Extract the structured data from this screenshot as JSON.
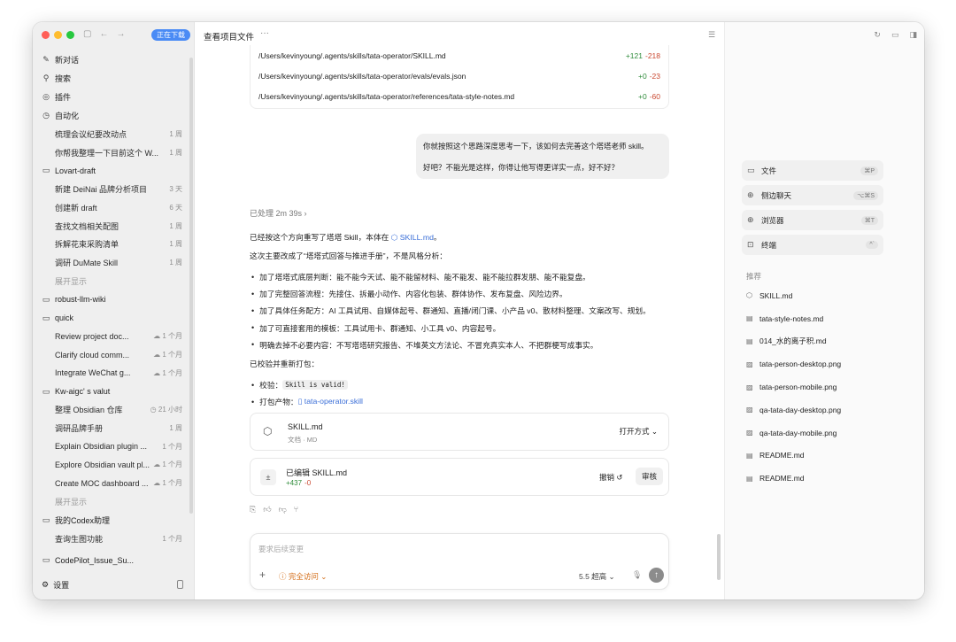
{
  "sidebar": {
    "download_badge": "正在下载",
    "top": [
      {
        "label": "新对话",
        "icon": "edit-icon"
      },
      {
        "label": "搜索",
        "icon": "search-icon"
      },
      {
        "label": "插件",
        "icon": "plugin-icon"
      }
    ],
    "automation": {
      "label": "自动化",
      "icon": "clock-icon"
    },
    "automation_items": [
      {
        "label": "梳理会议纪要改动点",
        "meta": "1 周"
      },
      {
        "label": "你帮我整理一下目前这个 W...",
        "meta": "1 周"
      }
    ],
    "group_lovart": "Lovart-draft",
    "lovart_items": [
      {
        "label": "新建 DeiNai 品牌分析项目",
        "meta": "3 天"
      },
      {
        "label": "创建新 draft",
        "meta": "6 天"
      },
      {
        "label": "查找文档相关配图",
        "meta": "1 周"
      },
      {
        "label": "拆解花束采购清单",
        "meta": "1 周"
      },
      {
        "label": "调研 DuMate Skill",
        "meta": "1 周"
      }
    ],
    "show_more": "展开显示",
    "group_robust": "robust-llm-wiki",
    "group_quick": "quick",
    "quick_items": [
      {
        "label": "Review project doc...",
        "meta": "☁ 1 个月"
      },
      {
        "label": "Clarify cloud comm...",
        "meta": "☁ 1 个月"
      },
      {
        "label": "Integrate WeChat g...",
        "meta": "☁ 1 个月"
      }
    ],
    "group_kw": "Kw-aigc' s valut",
    "kw_items": [
      {
        "label": "整理 Obsidian 仓库",
        "meta": "◷ 21 小时"
      },
      {
        "label": "调研品牌手册",
        "meta": "1 周"
      },
      {
        "label": "Explain Obsidian plugin ...",
        "meta": "1 个月"
      },
      {
        "label": "Explore Obsidian vault pl...",
        "meta": "☁ 1 个月"
      },
      {
        "label": "Create MOC dashboard ...",
        "meta": "☁ 1 个月"
      }
    ],
    "show_more_2": "展开显示",
    "group_codex": "我的Codex助理",
    "codex_items": [
      {
        "label": "查询生图功能",
        "meta": "1 个月"
      }
    ],
    "group_codepilot": "CodePilot_Issue_Su...",
    "settings": "设置"
  },
  "main": {
    "title": "查看项目文件",
    "more": "···",
    "files": [
      {
        "path": "/Users/kevinyoung/.agents/skills/tata-operator/SKILL.md",
        "add": "+121",
        "del": "-218"
      },
      {
        "path": "/Users/kevinyoung/.agents/skills/tata-operator/evals/evals.json",
        "add": "+0",
        "del": "-23"
      },
      {
        "path": "/Users/kevinyoung/.agents/skills/tata-operator/references/tata-style-notes.md",
        "add": "+0",
        "del": "-60"
      }
    ],
    "user_msg_1": "你就按照这个思路深度思考一下，该如何去完善这个塔塔老师 skill。",
    "user_msg_2": "好吧？不能光是这样，你得让他写得更详实一点，好不好？",
    "processed": "已处理 2m 39s",
    "reply_intro_prefix": "已经按这个方向重写了塔塔 Skill，本体在",
    "reply_intro_link": "SKILL.md",
    "reply_intro_suffix": "。",
    "reply_line2": "这次主要改成了“塔塔式回答与推进手册”，不是风格分析：",
    "bullets": [
      "加了塔塔式底层判断：能不能今天试、能不能留材料、能不能发、能不能拉群发朋、能不能复盘。",
      "加了完整回答流程：先接住、拆最小动作、内容化包装、群体协作、发布复盘、风险边界。",
      "加了具体任务配方：AI 工具试用、自媒体起号、群通知、直播/闭门课、小产品 v0、散材料整理、文案改写、规划。",
      "加了可直接套用的模板：工具试用卡、群通知、小工具 v0、内容起号。",
      "明确去掉不必要内容：不写塔塔研究报告、不堆英文方法论、不冒充真实本人、不把群梗写成事实。"
    ],
    "verified": "已校验并重新打包：",
    "check_label": "校验：",
    "check_code": "Skill is valid!",
    "package_label": "打包产物：",
    "package_link": "tata-operator.skill",
    "attachment": {
      "name": "SKILL.md",
      "meta": "文档 · MD",
      "open": "打开方式"
    },
    "edited": {
      "name": "已编辑 SKILL.md",
      "add": "+437",
      "del": "-0",
      "undo": "撤销",
      "review": "审核"
    },
    "composer": {
      "placeholder": "要求后续变更",
      "access": "完全访问",
      "model": "5.5 超高"
    }
  },
  "right": {
    "tools": [
      {
        "label": "文件",
        "kbd": "⌘P",
        "icon": "file-icon"
      },
      {
        "label": "侧边聊天",
        "kbd": "⌥⌘S",
        "icon": "chat-icon"
      },
      {
        "label": "浏览器",
        "kbd": "⌘T",
        "icon": "globe-icon"
      },
      {
        "label": "终端",
        "kbd": "^`",
        "icon": "terminal-icon"
      }
    ],
    "recommend_title": "推荐",
    "recommend": [
      {
        "label": "SKILL.md",
        "icon": "cube-icon"
      },
      {
        "label": "tata-style-notes.md",
        "icon": "doc-icon"
      },
      {
        "label": "014_水的离子积.md",
        "icon": "doc-icon"
      },
      {
        "label": "tata-person-desktop.png",
        "icon": "image-icon"
      },
      {
        "label": "tata-person-mobile.png",
        "icon": "image-icon"
      },
      {
        "label": "qa-tata-day-desktop.png",
        "icon": "image-icon"
      },
      {
        "label": "qa-tata-day-mobile.png",
        "icon": "image-icon"
      },
      {
        "label": "README.md",
        "icon": "doc-icon"
      },
      {
        "label": "README.md",
        "icon": "doc-icon"
      }
    ]
  }
}
